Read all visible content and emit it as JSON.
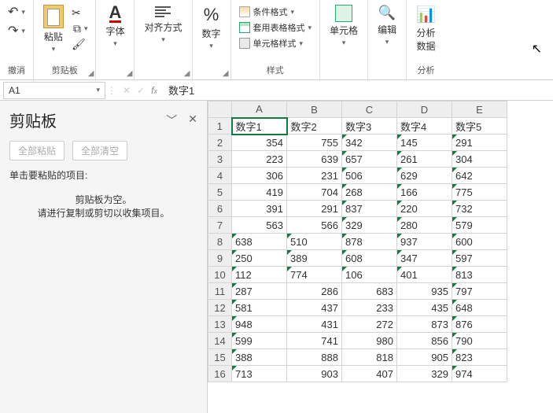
{
  "ribbon": {
    "undo_group": "撤消",
    "clipboard_group": "剪贴板",
    "paste": "粘贴",
    "font_group": "字体",
    "align_group": "对齐方式",
    "number_group": "数字",
    "styles_group": "样式",
    "cond_fmt": "条件格式",
    "tbl_fmt": "套用表格格式",
    "cell_style": "单元格样式",
    "cells_group": "单元格",
    "editing_group": "编辑",
    "analysis_group": "分析",
    "analysis_btn": "分析\n数据"
  },
  "namebox": "A1",
  "formula": "数字1",
  "clip_pane": {
    "title": "剪贴板",
    "paste_all": "全部粘贴",
    "clear_all": "全部清空",
    "hint": "单击要粘贴的项目:",
    "empty1": "剪贴板为空。",
    "empty2": "请进行复制或剪切以收集项目。"
  },
  "chart_data": {
    "type": "table",
    "columns": [
      "A",
      "B",
      "C",
      "D",
      "E"
    ],
    "headers": [
      "数字1",
      "数字2",
      "数字3",
      "数字4",
      "数字5"
    ],
    "rows": [
      {
        "r": 2,
        "A": 354,
        "B": 755,
        "C": "342",
        "D": "145",
        "E": "291"
      },
      {
        "r": 3,
        "A": 223,
        "B": 639,
        "C": "657",
        "D": "261",
        "E": "304"
      },
      {
        "r": 4,
        "A": 306,
        "B": 231,
        "C": "506",
        "D": "629",
        "E": "642"
      },
      {
        "r": 5,
        "A": 419,
        "B": 704,
        "C": "268",
        "D": "166",
        "E": "775"
      },
      {
        "r": 6,
        "A": 391,
        "B": 291,
        "C": "837",
        "D": "220",
        "E": "732"
      },
      {
        "r": 7,
        "A": 563,
        "B": 566,
        "C": "329",
        "D": "280",
        "E": "579"
      },
      {
        "r": 8,
        "A": "638",
        "B": "510",
        "C": "878",
        "D": "937",
        "E": "600"
      },
      {
        "r": 9,
        "A": "250",
        "B": "389",
        "C": "608",
        "D": "347",
        "E": "597"
      },
      {
        "r": 10,
        "A": "112",
        "B": "774",
        "C": "106",
        "D": "401",
        "E": "813"
      },
      {
        "r": 11,
        "A": "287",
        "B": 286,
        "C": 683,
        "D": 935,
        "E": "797"
      },
      {
        "r": 12,
        "A": "581",
        "B": 437,
        "C": 233,
        "D": 435,
        "E": "648"
      },
      {
        "r": 13,
        "A": "948",
        "B": 431,
        "C": 272,
        "D": 873,
        "E": "876"
      },
      {
        "r": 14,
        "A": "599",
        "B": 741,
        "C": 980,
        "D": 856,
        "E": "790"
      },
      {
        "r": 15,
        "A": "388",
        "B": 888,
        "C": 818,
        "D": 905,
        "E": "823"
      },
      {
        "r": 16,
        "A": "713",
        "B": 903,
        "C": 407,
        "D": 329,
        "E": "974"
      }
    ],
    "text_cells_have_green_triangle": true
  }
}
